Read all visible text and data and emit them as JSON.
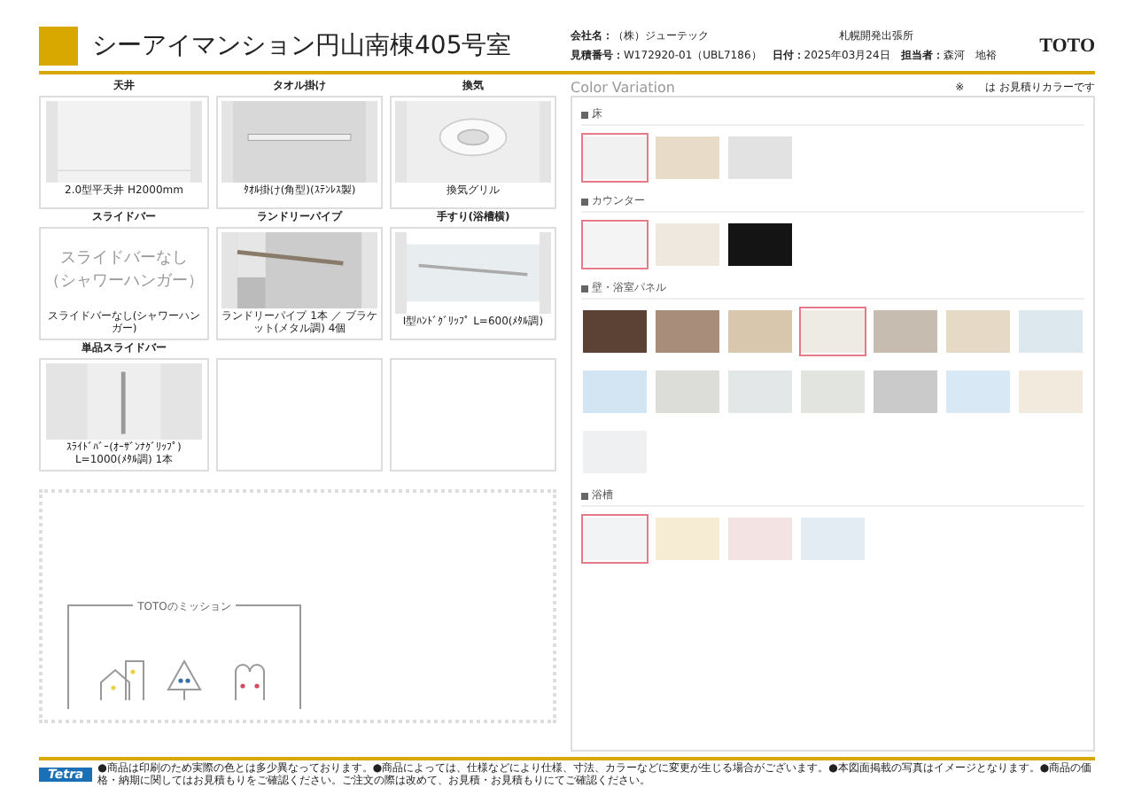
{
  "header": {
    "title": "シーアイマンション円山南棟405号室",
    "company_label": "会社名：",
    "company": "（株）ジューテック",
    "office": "札幌開発出張所",
    "estimate_label": "見積番号：",
    "estimate_no": "W172920-01（UBL7186）",
    "date_label": "日付：",
    "date": "2025年03月24日",
    "person_label": "担当者：",
    "person": "森河　地裕",
    "brand": "TOTO"
  },
  "items": [
    {
      "title": "天井",
      "caption": "2.0型平天井 H2000mm",
      "kind": "ceiling"
    },
    {
      "title": "タオル掛け",
      "caption": "ﾀｵﾙ掛け(角型)(ｽﾃﾝﾚｽ製)",
      "kind": "towel"
    },
    {
      "title": "換気",
      "caption": "換気グリル",
      "kind": "vent"
    },
    {
      "title": "スライドバー",
      "caption": "スライドバーなし(シャワーハンガー)",
      "kind": "text",
      "lines": [
        "スライドバーなし",
        "（シャワーハンガー）"
      ]
    },
    {
      "title": "ランドリーパイプ",
      "caption": "ランドリーパイプ 1本 ／ ブラケット(メタル調) 4個",
      "kind": "laundry"
    },
    {
      "title": "手すり(浴槽横)",
      "caption": "I型ﾊﾝﾄﾞｸﾞﾘｯﾌﾟ L=600(ﾒﾀﾙ調)",
      "kind": "rail"
    },
    {
      "title": "単品スライドバー",
      "caption": "ｽﾗｲﾄﾞﾊﾞｰ(ｵｰｻﾞﾝﾅｸﾞﾘｯﾌﾟ) L=1000(ﾒﾀﾙ調) 1本",
      "kind": "slidebar"
    },
    {
      "kind": "empty"
    },
    {
      "kind": "empty"
    }
  ],
  "mission": {
    "title": "TOTOのミッション"
  },
  "colors": {
    "title": "Color Variation",
    "legend": "※　　は お見積りカラーです",
    "groups": [
      {
        "name": "床",
        "swatches": [
          {
            "color": "#f1f1f1",
            "selected": true
          },
          {
            "color": "#e8dcc8",
            "selected": false
          },
          {
            "color": "#e2e2e2",
            "selected": false
          }
        ]
      },
      {
        "name": "カウンター",
        "swatches": [
          {
            "color": "#f4f4f4",
            "selected": true
          },
          {
            "color": "#efe8de",
            "selected": false
          },
          {
            "color": "#141414",
            "selected": false
          }
        ]
      },
      {
        "name": "壁・浴室パネル",
        "swatches": [
          {
            "color": "#5b4235",
            "selected": false
          },
          {
            "color": "#a88e7a",
            "selected": false
          },
          {
            "color": "#d9c7ad",
            "selected": false
          },
          {
            "color": "#eeeae4",
            "selected": true
          },
          {
            "color": "#c7bcb0",
            "selected": false
          },
          {
            "color": "#e6d9c5",
            "selected": false
          },
          {
            "color": "#dde7ee",
            "selected": false
          },
          {
            "color": "#d3e5f2",
            "selected": false
          },
          {
            "color": "#dcdcd8",
            "selected": false
          },
          {
            "color": "#e3e7e8",
            "selected": false
          },
          {
            "color": "#e2e4e0",
            "selected": false
          },
          {
            "color": "#cacaca",
            "selected": false
          },
          {
            "color": "#d8e9f5",
            "selected": false
          },
          {
            "color": "#f2ebdd",
            "selected": false
          },
          {
            "color": "#eff0f2",
            "selected": false
          }
        ]
      },
      {
        "name": "浴槽",
        "swatches": [
          {
            "color": "#f2f3f5",
            "selected": true
          },
          {
            "color": "#f5ecd3",
            "selected": false
          },
          {
            "color": "#f4e3e3",
            "selected": false
          },
          {
            "color": "#e3ecf3",
            "selected": false
          }
        ]
      }
    ]
  },
  "footer": {
    "logo": "Tetra",
    "notes": "●商品は印刷のため実際の色とは多少異なっております。●商品によっては、仕様などにより仕様、寸法、カラーなどに変更が生じる場合がございます。●本図面掲載の写真はイメージとなります。●商品の価格・納期に関してはお見積もりをご確認ください。ご注文の際は改めて、お見積・お見積もりにてご確認ください。"
  }
}
